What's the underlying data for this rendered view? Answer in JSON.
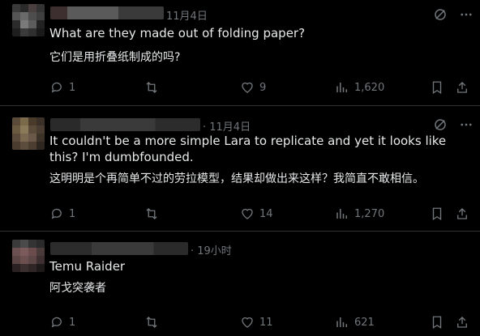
{
  "tweets": [
    {
      "time": "11月4日",
      "text_en": "What are they made out of folding paper?",
      "text_zh": "它们是用折叠纸制成的吗?",
      "replies": "1",
      "retweets": "",
      "likes": "9",
      "views": "1,620"
    },
    {
      "time": "· 11月4日",
      "text_en": "It couldn't be a more simple Lara to replicate and yet it looks like this? I'm dumbfounded.",
      "text_zh": "这明明是个再简单不过的劳拉模型，结果却做出来这样？我简直不敢相信。",
      "replies": "1",
      "retweets": "",
      "likes": "14",
      "views": "1,270"
    },
    {
      "time": "· 19小时",
      "text_en": "Temu Raider",
      "text_zh": "阿戈突袭者",
      "replies": "1",
      "retweets": "",
      "likes": "11",
      "views": "621"
    }
  ],
  "colors": {
    "background": "#000000",
    "text": "#e7e9ea",
    "muted": "#71767b",
    "divider": "#2f3336"
  },
  "icons": [
    "grok-icon",
    "more-icon",
    "reply-icon",
    "retweet-icon",
    "like-icon",
    "views-icon",
    "bookmark-icon",
    "share-icon"
  ]
}
